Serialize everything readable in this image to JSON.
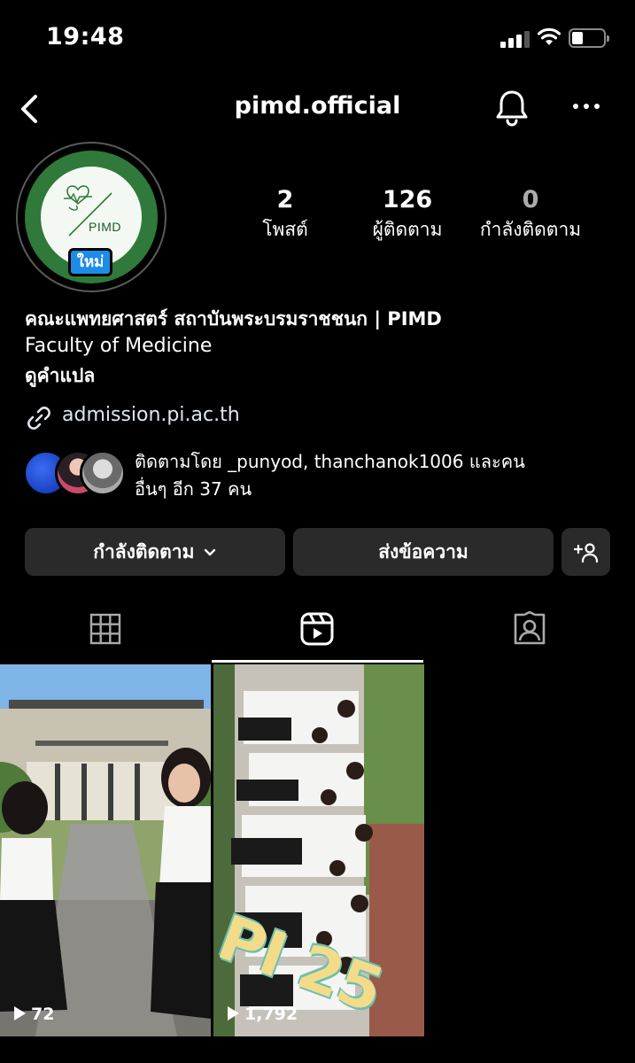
{
  "status_bar": {
    "time": "19:48"
  },
  "header": {
    "username": "pimd.official"
  },
  "profile": {
    "avatar_logo_text": "PIMD",
    "new_badge": "ใหม่",
    "stats": [
      {
        "value": "2",
        "label": "โพสต์"
      },
      {
        "value": "126",
        "label": "ผู้ติดตาม"
      },
      {
        "value": "0",
        "label": "กำลังติดตาม"
      }
    ],
    "bio_name": "คณะแพทยศาสตร์ สถาบันพระบรมราชชนก | PIMD",
    "bio_category": "Faculty of Medicine",
    "see_translation": "ดูคำแปล",
    "link": "admission.pi.ac.th",
    "followed_by_line1": "ติดตามโดย _punyod, thanchanok1006 และคน",
    "followed_by_line2": "อื่นๆ อีก 37 คน"
  },
  "actions": {
    "following_label": "กำลังติดตาม",
    "message_label": "ส่งข้อความ"
  },
  "reels": [
    {
      "views": "72"
    },
    {
      "views": "1,792",
      "overlay_text": "PI 25"
    }
  ],
  "colors": {
    "background": "#000000",
    "button_bg": "#2a2a2a",
    "badge_blue": "#1d8ce8",
    "logo_green": "#2f7a3a"
  }
}
